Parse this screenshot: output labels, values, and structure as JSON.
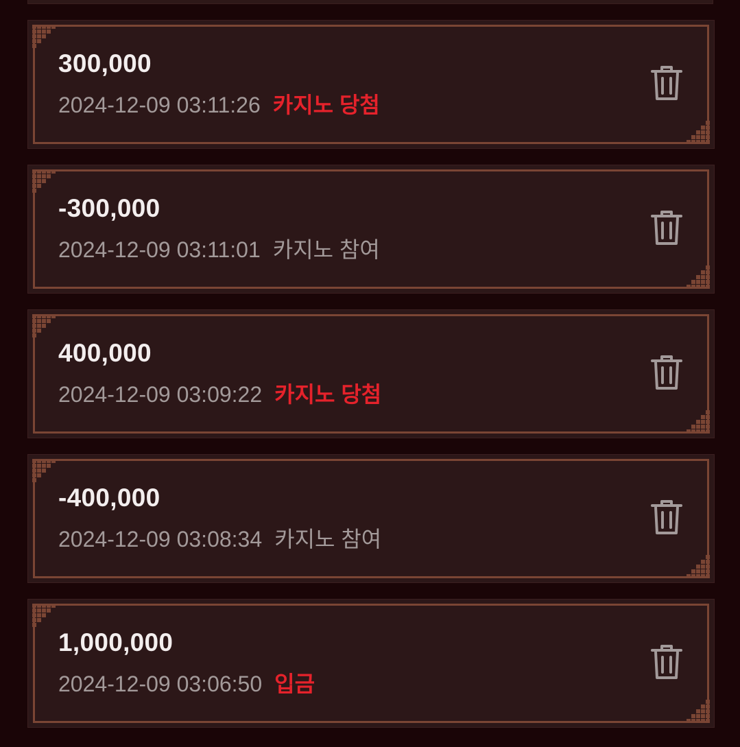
{
  "transactions": [
    {
      "amount": "300,000",
      "datetime": "2024-12-09 03:11:26",
      "label": "카지노 당첨",
      "kind": "win"
    },
    {
      "amount": "-300,000",
      "datetime": "2024-12-09 03:11:01",
      "label": "카지노 참여",
      "kind": "bet"
    },
    {
      "amount": "400,000",
      "datetime": "2024-12-09 03:09:22",
      "label": "카지노 당첨",
      "kind": "win"
    },
    {
      "amount": "-400,000",
      "datetime": "2024-12-09 03:08:34",
      "label": "카지노 참여",
      "kind": "bet"
    },
    {
      "amount": "1,000,000",
      "datetime": "2024-12-09 03:06:50",
      "label": "입금",
      "kind": "deposit"
    }
  ],
  "icons": {
    "delete": "trash-icon",
    "corner": "corner-ornament-icon"
  },
  "colors": {
    "background": "#1a0507",
    "card": "#2c1718",
    "border": "#7a4534",
    "highlight_label": "#e5222b",
    "muted_text": "#a39a9a",
    "amount_text": "#f3eeee"
  }
}
